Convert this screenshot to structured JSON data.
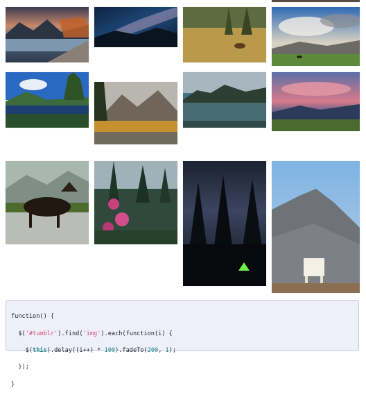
{
  "gallery": {
    "photos": [
      {
        "name": "lake-sunset-photo",
        "subject": "mountain lake with rocky shore at sunset"
      },
      {
        "name": "milky-way-photo",
        "subject": "milky way over mountains"
      },
      {
        "name": "elk-meadow-photo",
        "subject": "elk in golden meadow"
      },
      {
        "name": "bison-plains-photo",
        "subject": "bison grazing on plains under dramatic sky"
      },
      {
        "name": "mountain-reflection-photo",
        "subject": "mountain reflected in calm lake"
      },
      {
        "name": "autumn-peaks-photo",
        "subject": "autumn trees below rugged peaks"
      },
      {
        "name": "misty-lake-photo",
        "subject": "misty forested lake"
      },
      {
        "name": "pink-sunset-field-photo",
        "subject": "pink clouds over field with animals"
      },
      {
        "name": "moose-river-photo",
        "subject": "moose standing in river"
      },
      {
        "name": "fireweed-forest-photo",
        "subject": "pink fireweed flowers in forest"
      },
      {
        "name": "night-tent-photo",
        "subject": "green tent under starry sky among pines"
      },
      {
        "name": "mountain-goat-photo",
        "subject": "mountain goat on rocky peak"
      }
    ]
  },
  "code": {
    "line1": "function() {",
    "line2_pre": "  $(",
    "line2_str1": "'#tumblr'",
    "line2_mid": ").find(",
    "line2_str2": "'img'",
    "line2_post": ").each(function(i) {",
    "line3_pre": "    $(",
    "line3_this": "this",
    "line3_mid": ").delay((i++) * ",
    "line3_num1": "100",
    "line3_mid2": ").fadeTo(",
    "line3_num2": "200",
    "line3_sep": ", ",
    "line3_num3": "1",
    "line3_post": ");",
    "line4": "  });",
    "line5": "}"
  },
  "colors": {
    "code_background": "#eeeff8",
    "code_border": "#c7c9de",
    "string": "#d14b7a",
    "keyword_this": "#1f8a8a"
  }
}
